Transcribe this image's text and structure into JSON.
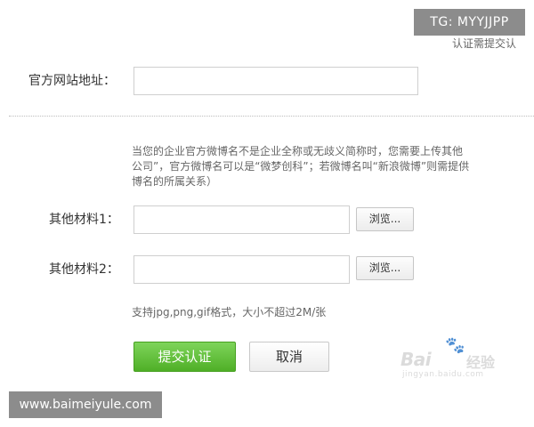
{
  "overlay": {
    "tag": "TG: MYYJJPP",
    "site": "www.baimeiyule.com"
  },
  "header": {
    "top_note": "认证需提交认"
  },
  "form": {
    "website_label": "官方网站地址：",
    "website_value": "",
    "note_lines": [
      "当您的企业官方微博名不是企业全称或无歧义简称时，您需要上传其他",
      "公司”，官方微博名可以是“微梦创科”；若微博名叫“新浪微博”则需提供",
      "博名的所属关系）"
    ],
    "material1_label": "其他材料1：",
    "material2_label": "其他材料2：",
    "browse_label": "浏览...",
    "hint": "支持jpg,png,gif格式，大小不超过2M/张",
    "submit_label": "提交认证",
    "cancel_label": "取消"
  },
  "watermark": {
    "brand": "Bai",
    "brand2": "经验",
    "paw": "🐾",
    "sub": "jingyan.baidu.com"
  },
  "colors": {
    "submit_green": "#5cbf33",
    "overlay_gray": "#8c8c8c",
    "note_gray": "#666666"
  }
}
